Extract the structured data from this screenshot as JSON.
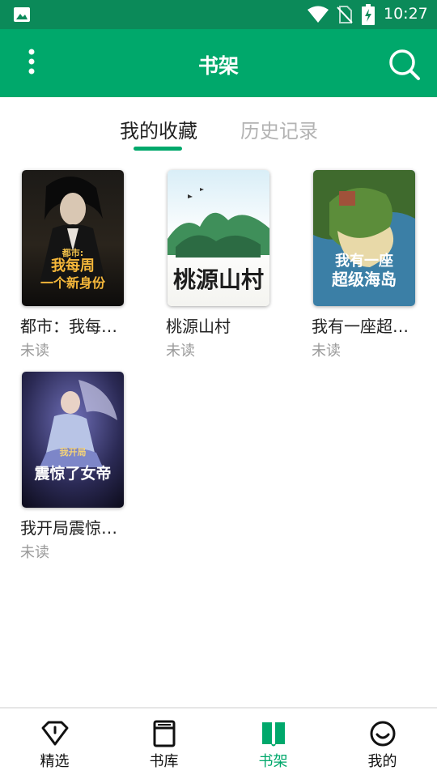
{
  "status_bar": {
    "time": "10:27",
    "icons": [
      "picture-icon",
      "wifi-icon",
      "no-sim-icon",
      "battery-charging-icon"
    ]
  },
  "app_bar": {
    "title": "书架",
    "menu_icon": "more-vertical-icon",
    "search_icon": "search-icon",
    "color": "#00a86b"
  },
  "tabs": [
    {
      "label": "我的收藏",
      "active": true
    },
    {
      "label": "历史记录",
      "active": false
    }
  ],
  "books": [
    {
      "title": "都市：我每…",
      "status": "未读",
      "cover_text": [
        "都市:",
        "我每周",
        "一个新身份"
      ]
    },
    {
      "title": "桃源山村",
      "status": "未读",
      "cover_text": [
        "桃源山村"
      ]
    },
    {
      "title": "我有一座超…",
      "status": "未读",
      "cover_text": [
        "我有一座",
        "超级海岛"
      ]
    },
    {
      "title": "我开局震惊…",
      "status": "未读",
      "cover_text": [
        "我开局",
        "震惊了女帝"
      ]
    }
  ],
  "bottom_nav": [
    {
      "label": "精选",
      "icon": "diamond-icon",
      "active": false
    },
    {
      "label": "书库",
      "icon": "book-icon",
      "active": false
    },
    {
      "label": "书架",
      "icon": "bookshelf-icon",
      "active": true
    },
    {
      "label": "我的",
      "icon": "smiley-icon",
      "active": false
    }
  ],
  "colors": {
    "accent": "#00a86b",
    "status_bar": "#0b8a59",
    "inactive_tab": "#b3b3b3",
    "read_status": "#9a9a9a"
  }
}
